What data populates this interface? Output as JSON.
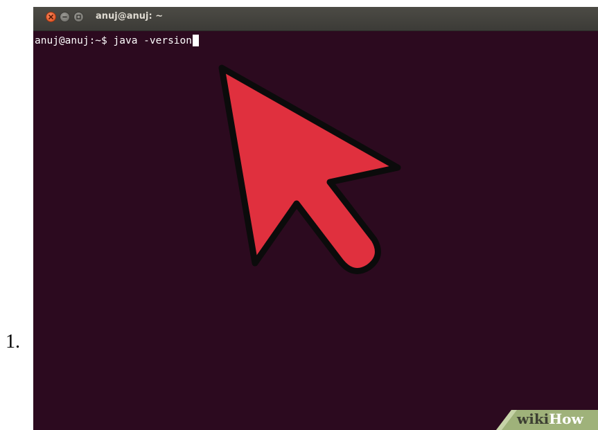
{
  "list_marker": "1.",
  "window": {
    "title": "anuj@anuj: ~",
    "buttons": {
      "close_icon": "close-icon",
      "minimize_icon": "minimize-icon",
      "maximize_icon": "maximize-icon"
    }
  },
  "terminal": {
    "prompt": "anuj@anuj:~$ ",
    "command": "java -version",
    "background_color": "#2c0a1f",
    "text_color": "#ffffff"
  },
  "annotation": {
    "icon": "pointer-arrow-icon",
    "color": "#e0303e"
  },
  "watermark": {
    "wiki": "wiki",
    "how": "How"
  }
}
